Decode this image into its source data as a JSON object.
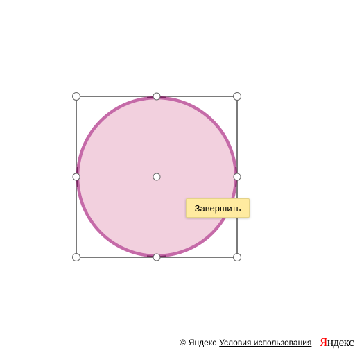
{
  "map": {
    "shape": {
      "type": "circle",
      "fill_color": "#f2d0de",
      "stroke_color": "#c56aa8",
      "stroke_dark_color": "#7a2a62",
      "frame_color": "#7a7a7a"
    },
    "finish_button_label": "Завершить"
  },
  "footer": {
    "copyright_symbol": "©",
    "copyright_text": "Яндекс",
    "terms_link": "Условия использования",
    "logo_first_letter": "Я",
    "logo_rest": "ндекс"
  }
}
